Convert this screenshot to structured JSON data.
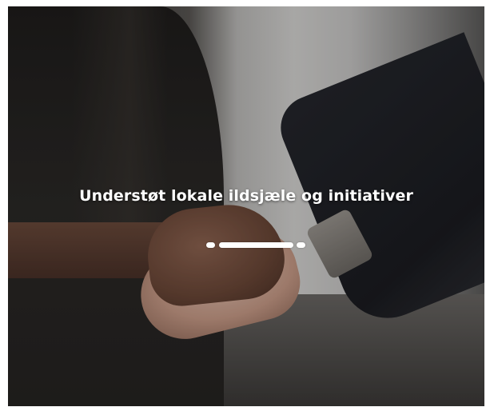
{
  "hero": {
    "headline": "Understøt lokale ildsjæle og initiativer",
    "background_image": "handshake-photo",
    "divider_color": "#ffffff",
    "text_color": "#ffffff"
  }
}
